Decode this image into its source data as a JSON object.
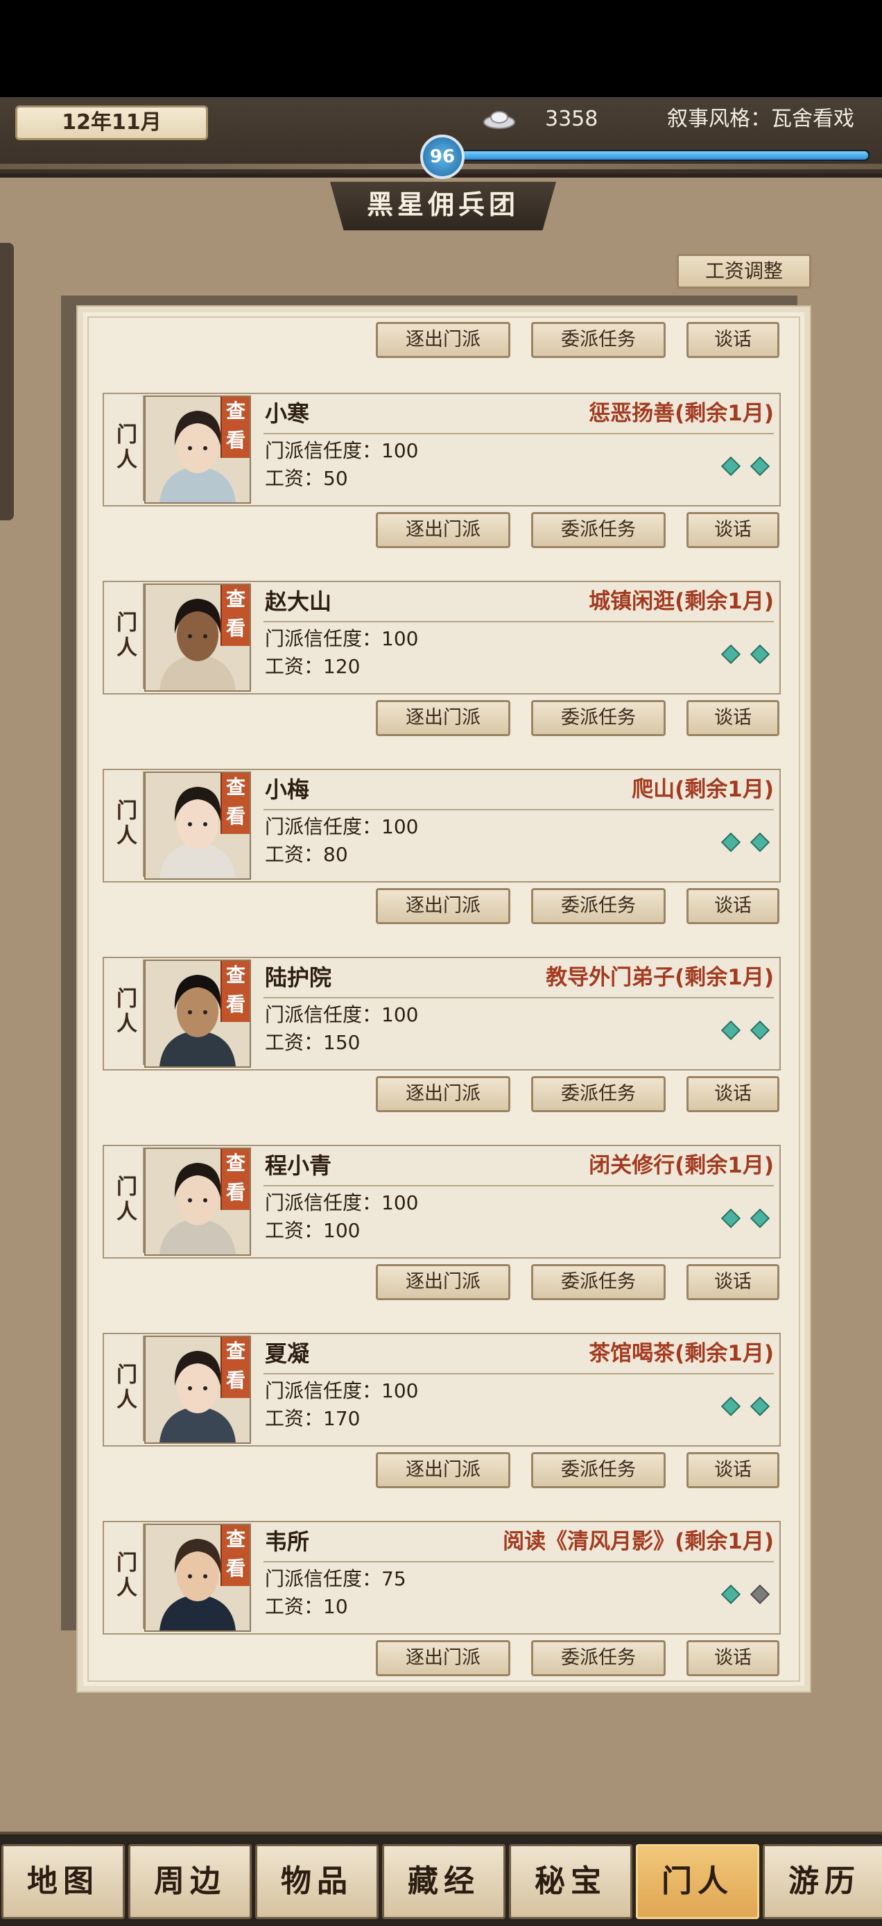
{
  "header": {
    "date": "12年11月",
    "silver": "3358",
    "narrative_style": "叙事风格：瓦舍看戏",
    "level": "96",
    "xp_fraction": 1.0
  },
  "title": "黑星佣兵团",
  "wage_adjust": "工资调整",
  "buttons": {
    "expel": "逐出门派",
    "assign": "委派任务",
    "talk": "谈话"
  },
  "card_side_label": "门人",
  "view_label": "查看",
  "members": [
    {
      "name": "小寒",
      "task": "惩恶扬善(剩余1月)",
      "trust": "门派信任度：100",
      "wage": "工资：50",
      "gems": [
        "on",
        "on"
      ]
    },
    {
      "name": "赵大山",
      "task": "城镇闲逛(剩余1月)",
      "trust": "门派信任度：100",
      "wage": "工资：120",
      "gems": [
        "on",
        "on"
      ]
    },
    {
      "name": "小梅",
      "task": "爬山(剩余1月)",
      "trust": "门派信任度：100",
      "wage": "工资：80",
      "gems": [
        "on",
        "on"
      ]
    },
    {
      "name": "陆护院",
      "task": "教导外门弟子(剩余1月)",
      "trust": "门派信任度：100",
      "wage": "工资：150",
      "gems": [
        "on",
        "on"
      ]
    },
    {
      "name": "程小青",
      "task": "闭关修行(剩余1月)",
      "trust": "门派信任度：100",
      "wage": "工资：100",
      "gems": [
        "on",
        "on"
      ]
    },
    {
      "name": "夏凝",
      "task": "茶馆喝茶(剩余1月)",
      "trust": "门派信任度：100",
      "wage": "工资：170",
      "gems": [
        "on",
        "on"
      ]
    },
    {
      "name": "韦所",
      "task": "阅读《清风月影》(剩余1月)",
      "trust": "门派信任度：75",
      "wage": "工资：10",
      "gems": [
        "on",
        "off"
      ]
    }
  ],
  "tabs": [
    "地图",
    "周边",
    "物品",
    "藏经",
    "秘宝",
    "门人",
    "游历"
  ],
  "active_tab": "门人",
  "colors": {
    "accent": "#c1542b",
    "task_text": "#a33b21",
    "gem_on": "#49b39f",
    "gem_off": "#7c7c7c",
    "active_tab": "#e0a653"
  }
}
